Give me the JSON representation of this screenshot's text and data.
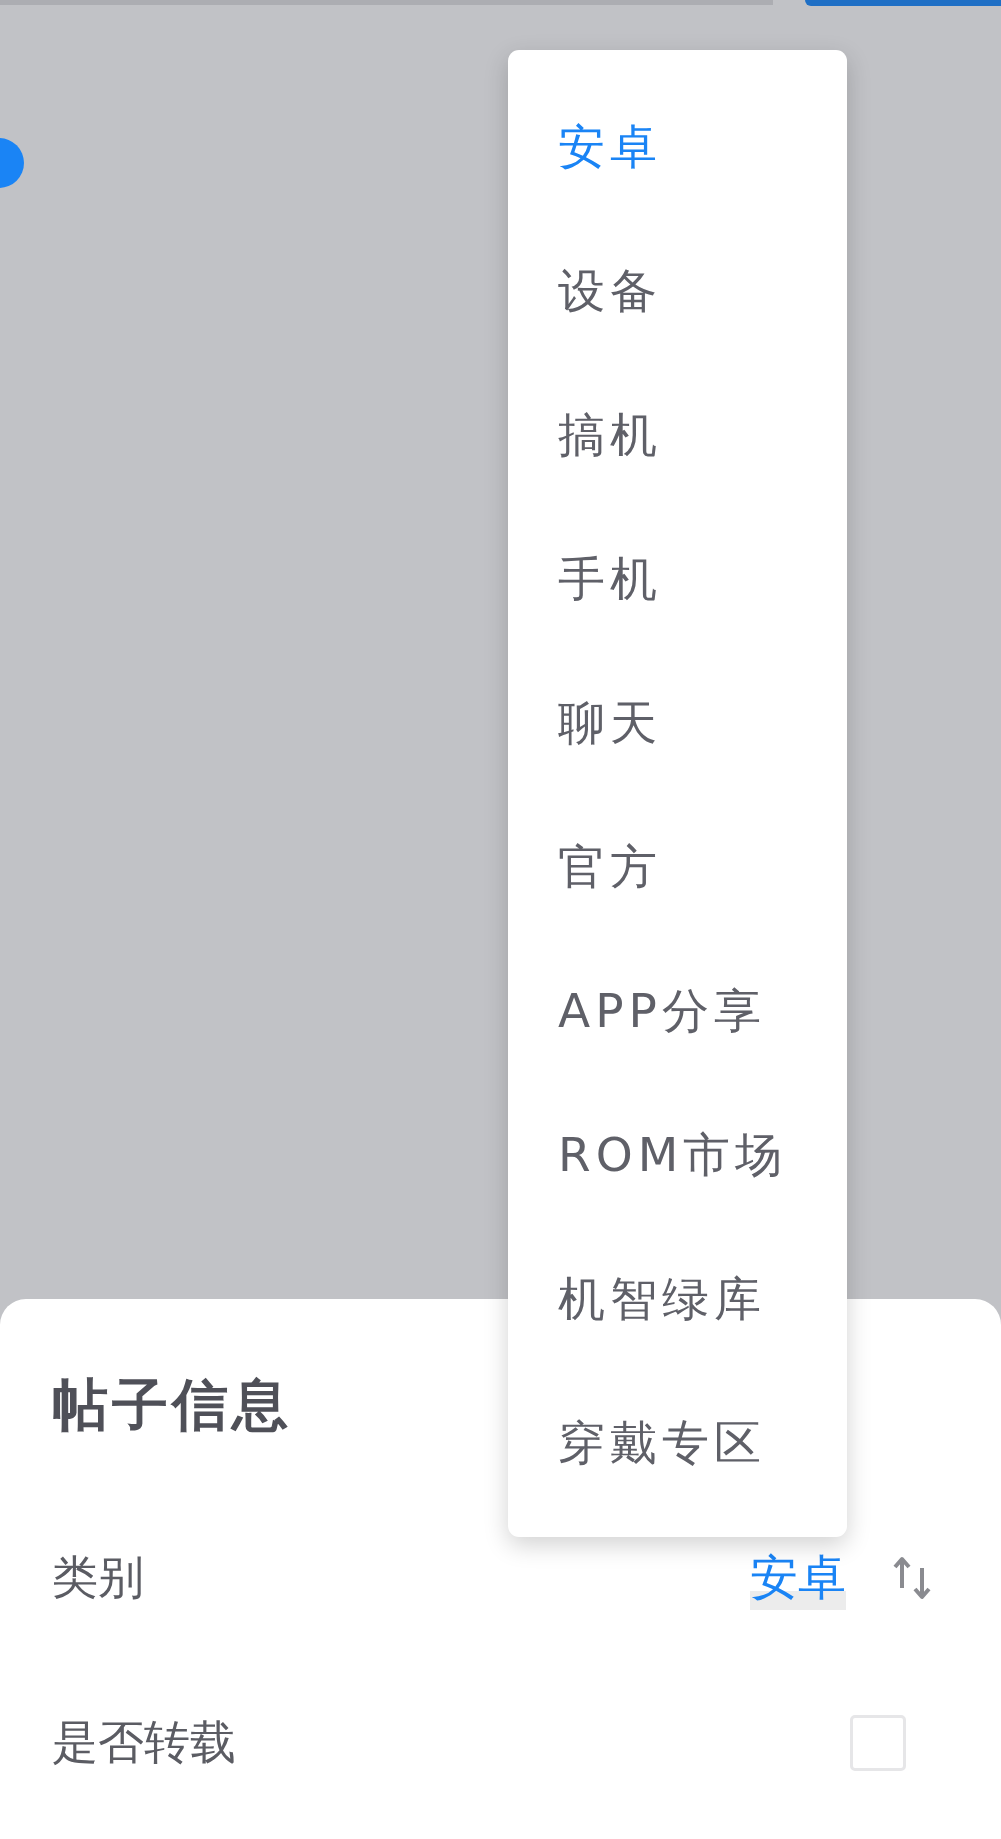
{
  "menu": {
    "items": [
      {
        "label": "安卓",
        "selected": true
      },
      {
        "label": "设备",
        "selected": false
      },
      {
        "label": "搞机",
        "selected": false
      },
      {
        "label": "手机",
        "selected": false
      },
      {
        "label": "聊天",
        "selected": false
      },
      {
        "label": "官方",
        "selected": false
      },
      {
        "label": "APP分享",
        "selected": false
      },
      {
        "label": "ROM市场",
        "selected": false
      },
      {
        "label": "机智绿库",
        "selected": false
      },
      {
        "label": "穿戴专区",
        "selected": false
      }
    ]
  },
  "sheet": {
    "title": "帖子信息",
    "rows": [
      {
        "kind": "select",
        "label": "类别",
        "value": "安卓"
      },
      {
        "kind": "checkbox",
        "label": "是否转载",
        "checked": false
      }
    ]
  }
}
